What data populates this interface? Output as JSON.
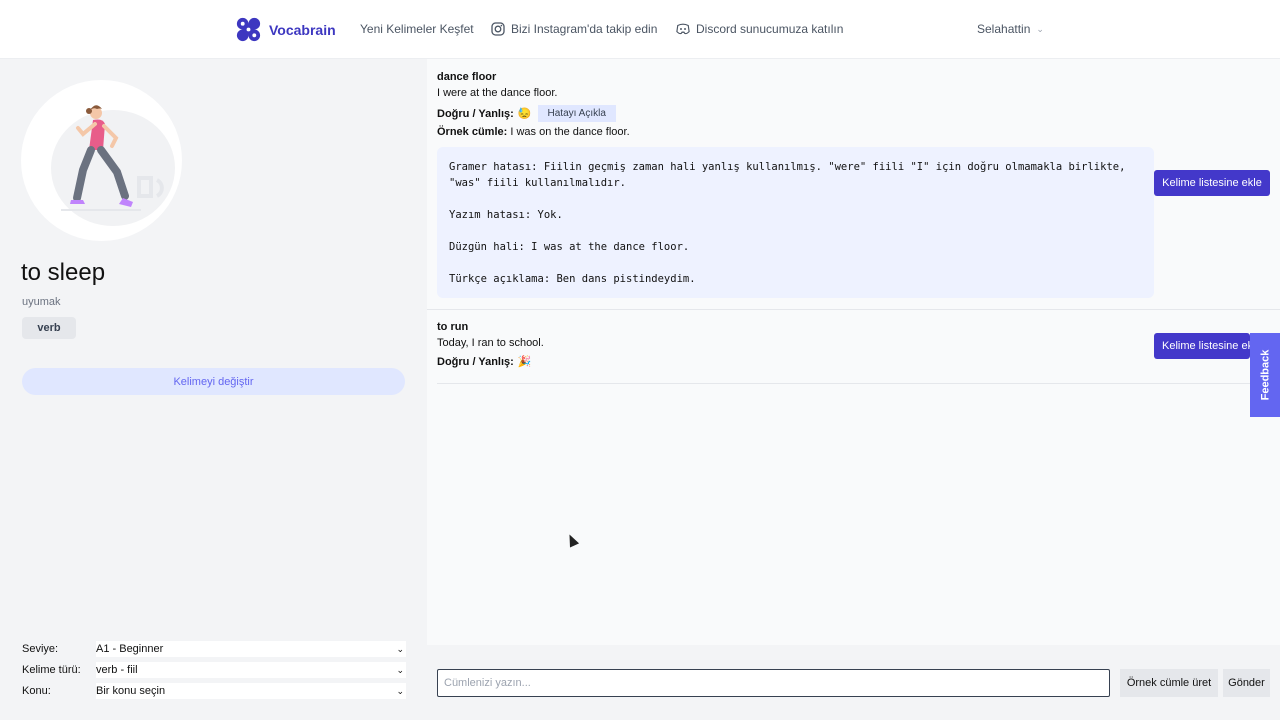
{
  "brand": {
    "name": "Vocabrain",
    "color": "#3d37c0"
  },
  "nav": {
    "discover": "Yeni Kelimeler Keşfet",
    "instagram": "Bizi Instagram'da takip edin",
    "discord": "Discord sunucumuza katılın",
    "user": "Selahattin"
  },
  "word": {
    "title": "to sleep",
    "translation": "uyumak",
    "part_of_speech": "verb",
    "change_label": "Kelimeyi değiştir"
  },
  "filters": [
    {
      "label": "Seviye:",
      "value": "A1 - Beginner"
    },
    {
      "label": "Kelime türü:",
      "value": "verb - fiil"
    },
    {
      "label": "Konu:",
      "value": "Bir konu seçin"
    }
  ],
  "entries": [
    {
      "word": "dance floor",
      "sentence": "I were at the dance floor.",
      "verdict_label": "Doğru / Yanlış:",
      "verdict_emoji": "😓",
      "explain_label": "Hatayı Açıkla",
      "example_label": "Örnek cümle:",
      "example_text": "I was on the dance floor.",
      "explanation": "Gramer hatası: Fiilin geçmiş zaman hali yanlış kullanılmış. \"were\" fiili \"I\" için doğru olmamakla birlikte, \"was\" fiili kullanılmalıdır.\n\nYazım hatası: Yok.\n\nDüzgün hali: I was at the dance floor.\n\nTürkçe açıklama: Ben dans pistindeydim.",
      "add_label": "Kelime listesine ekle"
    },
    {
      "word": "to run",
      "sentence": "Today, I ran to school.",
      "verdict_label": "Doğru / Yanlış:",
      "verdict_emoji": "🎉",
      "add_label": "Kelime listesine ekle"
    }
  ],
  "feedback_label": "Feedback",
  "input": {
    "placeholder": "Cümlenizi yazın...",
    "generate_label": "Örnek cümle üret",
    "send_label": "Gönder"
  }
}
